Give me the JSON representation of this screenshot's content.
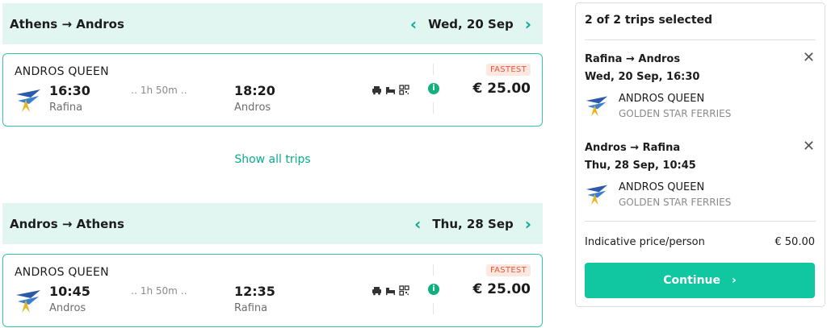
{
  "outbound": {
    "route": "Athens → Andros",
    "date": "Wed, 20 Sep",
    "trip": {
      "vessel": "ANDROS QUEEN",
      "depart_time": "16:30",
      "depart_port": "Rafina",
      "duration": "‥ 1h 50m ‥",
      "arrive_time": "18:20",
      "arrive_port": "Andros",
      "badge": "FASTEST",
      "price": "€ 25.00"
    },
    "show_all": "Show all trips"
  },
  "return": {
    "route": "Andros → Athens",
    "date": "Thu, 28 Sep",
    "trip": {
      "vessel": "ANDROS QUEEN",
      "depart_time": "10:45",
      "depart_port": "Andros",
      "duration": "‥ 1h 50m ‥",
      "arrive_time": "12:35",
      "arrive_port": "Rafina",
      "badge": "FASTEST",
      "price": "€ 25.00"
    }
  },
  "summary": {
    "title": "2 of 2 trips selected",
    "segments": [
      {
        "route": "Rafina → Andros",
        "datetime": "Wed, 20 Sep, 16:30",
        "vessel": "ANDROS QUEEN",
        "operator": "GOLDEN STAR FERRIES"
      },
      {
        "route": "Andros → Rafina",
        "datetime": "Thu, 28 Sep, 10:45",
        "vessel": "ANDROS QUEEN",
        "operator": "GOLDEN STAR FERRIES"
      }
    ],
    "indicative_label": "Indicative price/person",
    "indicative_value": "€ 50.00",
    "continue_label": "Continue"
  },
  "icons": {
    "prev": "chevron-left-icon",
    "next": "chevron-right-icon",
    "close": "close-icon",
    "info": "info-icon"
  },
  "colors": {
    "accent": "#0bab8e",
    "header_bg": "#e2f6f1",
    "badge_text": "#e2573b",
    "cta": "#10c7a2"
  }
}
